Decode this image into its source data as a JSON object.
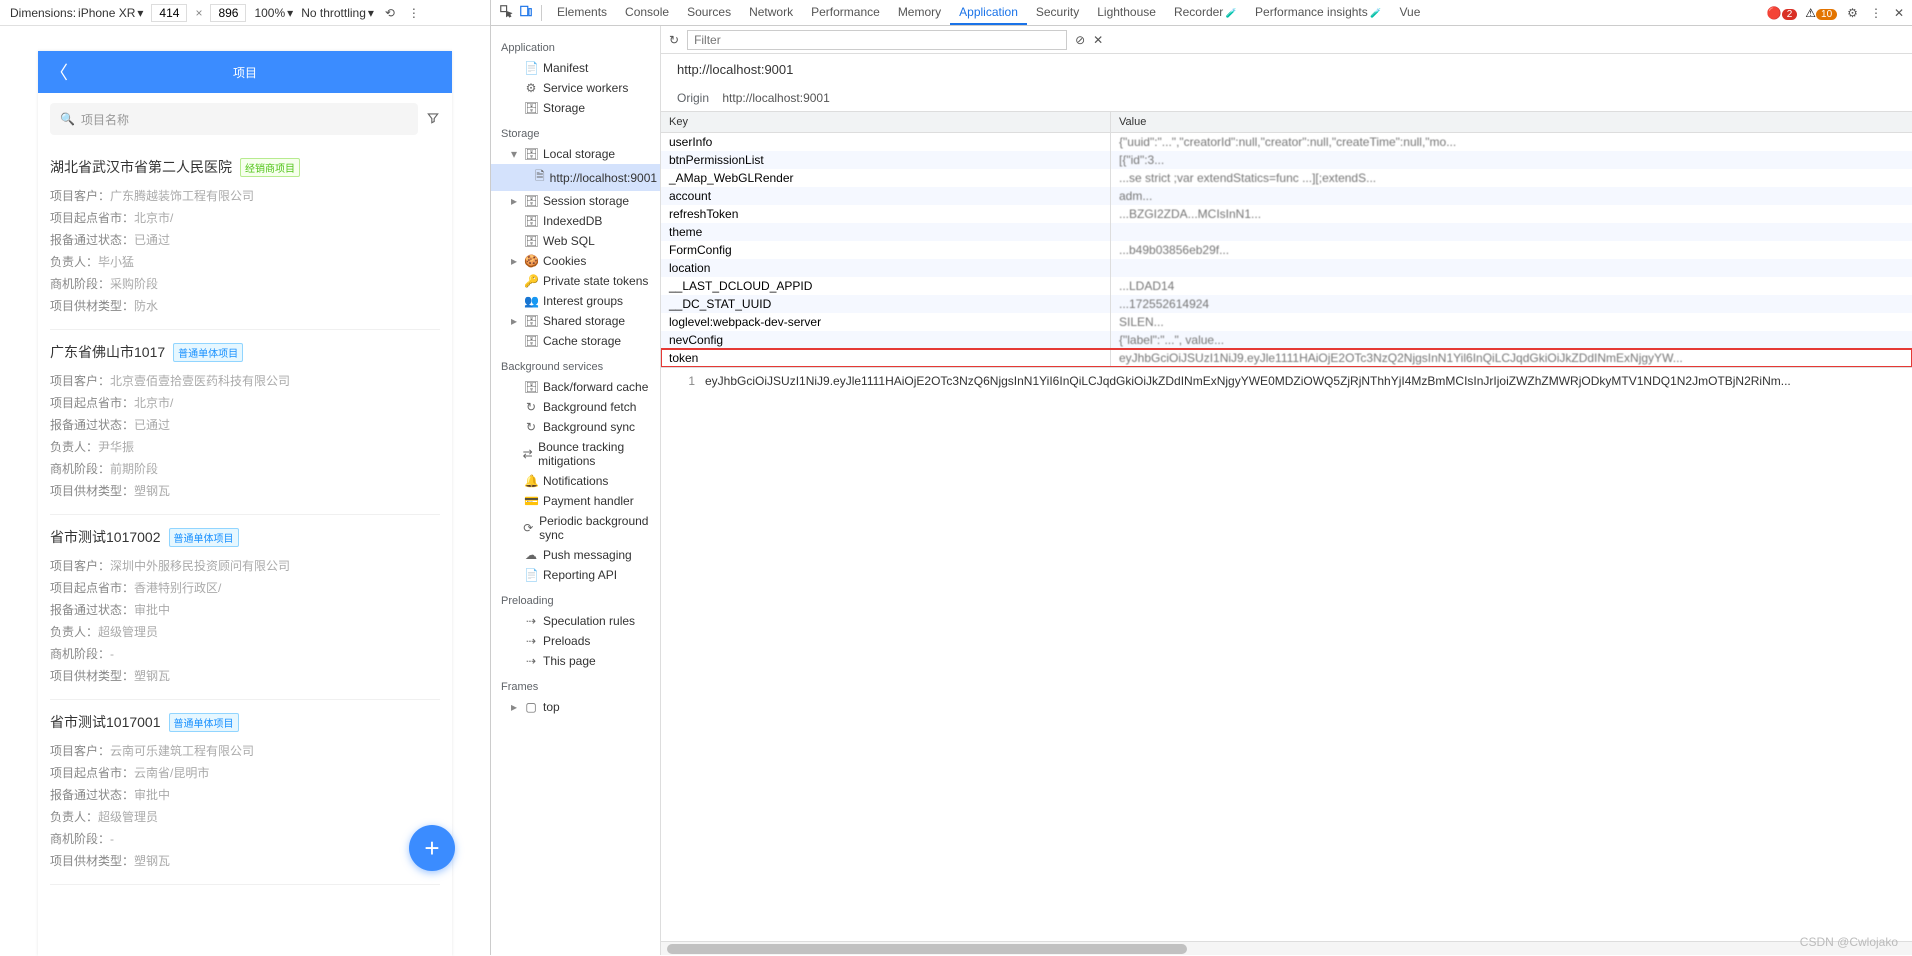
{
  "device_bar": {
    "dim_label": "Dimensions:",
    "device": "iPhone XR",
    "width": "414",
    "height": "896",
    "zoom": "100%",
    "throttle": "No throttling"
  },
  "phone": {
    "title": "项目",
    "search_placeholder": "项目名称",
    "items": [
      {
        "name": "湖北省武汉市省第二人民医院",
        "tag": "经销商项目",
        "tag_cls": "green",
        "fields": [
          {
            "l": "项目客户：",
            "v": "广东腾越装饰工程有限公司"
          },
          {
            "l": "项目起点省市：",
            "v": "北京市/"
          },
          {
            "l": "报备通过状态：",
            "v": "已通过"
          },
          {
            "l": "负责人：",
            "v": "毕小猛"
          },
          {
            "l": "商机阶段：",
            "v": "采购阶段"
          },
          {
            "l": "项目供材类型：",
            "v": "防水"
          }
        ]
      },
      {
        "name": "广东省佛山市1017",
        "tag": "普通单体项目",
        "tag_cls": "blue",
        "fields": [
          {
            "l": "项目客户：",
            "v": "北京壹佰壹拾壹医药科技有限公司"
          },
          {
            "l": "项目起点省市：",
            "v": "北京市/"
          },
          {
            "l": "报备通过状态：",
            "v": "已通过"
          },
          {
            "l": "负责人：",
            "v": "尹华振"
          },
          {
            "l": "商机阶段：",
            "v": "前期阶段"
          },
          {
            "l": "项目供材类型：",
            "v": "塑钢瓦"
          }
        ]
      },
      {
        "name": "省市测试1017002",
        "tag": "普通单体项目",
        "tag_cls": "blue",
        "fields": [
          {
            "l": "项目客户：",
            "v": "深圳中外服移民投资顾问有限公司"
          },
          {
            "l": "项目起点省市：",
            "v": "香港特别行政区/"
          },
          {
            "l": "报备通过状态：",
            "v": "审批中"
          },
          {
            "l": "负责人：",
            "v": "超级管理员"
          },
          {
            "l": "商机阶段：",
            "v": "-"
          },
          {
            "l": "项目供材类型：",
            "v": "塑钢瓦"
          }
        ]
      },
      {
        "name": "省市测试1017001",
        "tag": "普通单体项目",
        "tag_cls": "blue",
        "fields": [
          {
            "l": "项目客户：",
            "v": "云南可乐建筑工程有限公司"
          },
          {
            "l": "项目起点省市：",
            "v": "云南省/昆明市"
          },
          {
            "l": "报备通过状态：",
            "v": "审批中"
          },
          {
            "l": "负责人：",
            "v": "超级管理员"
          },
          {
            "l": "商机阶段：",
            "v": "-"
          },
          {
            "l": "项目供材类型：",
            "v": "塑钢瓦"
          }
        ]
      }
    ]
  },
  "devtools": {
    "tabs": [
      "Elements",
      "Console",
      "Sources",
      "Network",
      "Performance",
      "Memory",
      "Application",
      "Security",
      "Lighthouse",
      "Recorder",
      "Performance insights",
      "Vue"
    ],
    "active_tab": "Application",
    "err_count": "2",
    "warn_count": "10",
    "filter_placeholder": "Filter",
    "crumb": "http://localhost:9001",
    "origin_label": "Origin",
    "origin_value": "http://localhost:9001",
    "side": {
      "groups": [
        {
          "title": "Application",
          "items": [
            {
              "ic": "📄",
              "txt": "Manifest"
            },
            {
              "ic": "⚙",
              "txt": "Service workers"
            },
            {
              "ic": "🗄",
              "txt": "Storage"
            }
          ]
        },
        {
          "title": "Storage",
          "items": [
            {
              "arr": "▾",
              "ic": "🗄",
              "txt": "Local storage",
              "children": [
                {
                  "ic": "🗎",
                  "txt": "http://localhost:9001",
                  "sel": true
                }
              ]
            },
            {
              "arr": "▸",
              "ic": "🗄",
              "txt": "Session storage"
            },
            {
              "ic": "🗄",
              "txt": "IndexedDB"
            },
            {
              "ic": "🗄",
              "txt": "Web SQL"
            },
            {
              "arr": "▸",
              "ic": "🍪",
              "txt": "Cookies"
            },
            {
              "ic": "🔑",
              "txt": "Private state tokens"
            },
            {
              "ic": "👥",
              "txt": "Interest groups"
            },
            {
              "arr": "▸",
              "ic": "🗄",
              "txt": "Shared storage"
            },
            {
              "ic": "🗄",
              "txt": "Cache storage"
            }
          ]
        },
        {
          "title": "Background services",
          "items": [
            {
              "ic": "🗄",
              "txt": "Back/forward cache"
            },
            {
              "ic": "↻",
              "txt": "Background fetch"
            },
            {
              "ic": "↻",
              "txt": "Background sync"
            },
            {
              "ic": "⇄",
              "txt": "Bounce tracking mitigations"
            },
            {
              "ic": "🔔",
              "txt": "Notifications"
            },
            {
              "ic": "💳",
              "txt": "Payment handler"
            },
            {
              "ic": "⟳",
              "txt": "Periodic background sync"
            },
            {
              "ic": "☁",
              "txt": "Push messaging"
            },
            {
              "ic": "📄",
              "txt": "Reporting API"
            }
          ]
        },
        {
          "title": "Preloading",
          "items": [
            {
              "ic": "⇢",
              "txt": "Speculation rules"
            },
            {
              "ic": "⇢",
              "txt": "Preloads"
            },
            {
              "ic": "⇢",
              "txt": "This page"
            }
          ]
        },
        {
          "title": "Frames",
          "items": [
            {
              "arr": "▸",
              "ic": "▢",
              "txt": "top"
            }
          ]
        }
      ]
    },
    "table": {
      "head_key": "Key",
      "head_val": "Value",
      "rows": [
        {
          "k": "userInfo",
          "v": "{\"uuid\":\"...\",\"creatorId\":null,\"creator\":null,\"createTime\":null,\"mo..."
        },
        {
          "k": "btnPermissionList",
          "v": "[{\"id\":3..."
        },
        {
          "k": "_AMap_WebGLRender",
          "v": "...se strict ;var extendStatics=func ...][;extendS..."
        },
        {
          "k": "account",
          "v": "adm..."
        },
        {
          "k": "refreshToken",
          "v": "...BZGI2ZDA...MCIsInN1..."
        },
        {
          "k": "theme",
          "v": ""
        },
        {
          "k": "FormConfig",
          "v": "...b49b03856eb29f..."
        },
        {
          "k": "location",
          "v": ""
        },
        {
          "k": "__LAST_DCLOUD_APPID",
          "v": "...LDAD14"
        },
        {
          "k": "__DC_STAT_UUID",
          "v": "...172552614924"
        },
        {
          "k": "loglevel:webpack-dev-server",
          "v": "SILEN..."
        },
        {
          "k": "nevConfig",
          "v": "{\"label\":\"...\", value..."
        },
        {
          "k": "token",
          "v": "eyJhbGciOiJSUzI1NiJ9.eyJle1111HAiOjE2OTc3NzQ2NjgsInN1Yil6InQiLCJqdGkiOiJkZDdINmExNjgyYW...",
          "hl": true
        }
      ]
    },
    "detail_line": "1",
    "detail_text": "eyJhbGciOiJSUzI1NiJ9.eyJle1111HAiOjE2OTc3NzQ6NjgsInN1YiI6InQiLCJqdGkiOiJkZDdINmExNjgyYWE0MDZiOWQ5ZjRjNThhYjI4MzBmMCIsInJrIjoiZWZhZMWRjODkyMTV1NDQ1N2JmOTBjN2RiNm..."
  },
  "watermark": "CSDN @Cwlojako"
}
